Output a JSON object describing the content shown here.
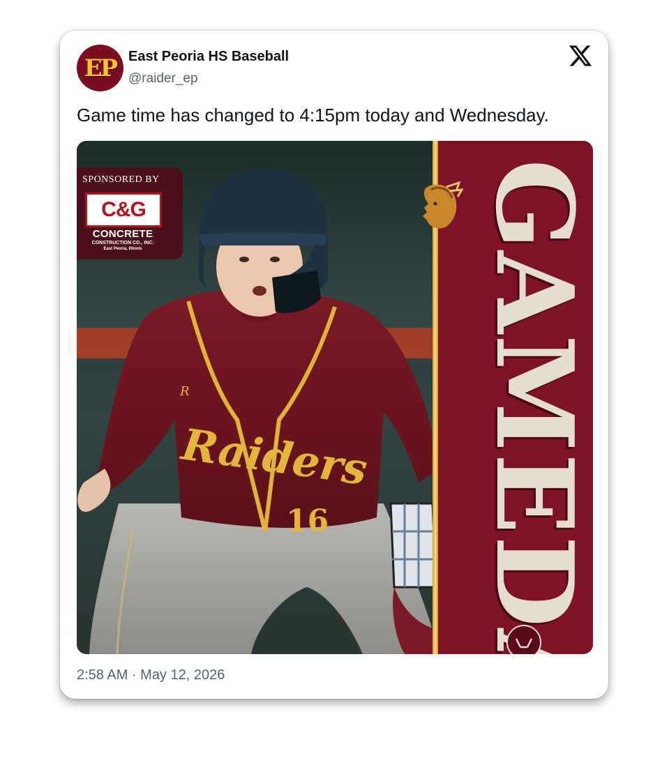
{
  "author": {
    "name": "East Peoria HS Baseball",
    "handle": "@raider_ep",
    "avatar_text": "EP",
    "avatar_icon": "ep-logo-icon"
  },
  "platform_icon": "x-logo-icon",
  "tweet": {
    "text": "Game time has changed to 4:15pm today and Wednesday.",
    "timestamp": "2:58 AM · May 12, 2026"
  },
  "media": {
    "sponsor_label": "SPONSORED BY",
    "sponsor_logo_text": "C&G",
    "sponsor_name": "CONCRETE",
    "sponsor_sub": "CONSTRUCTION CO., INC.",
    "sponsor_city": "East Peoria, Illinois",
    "banner_text": "GAMEDAY",
    "jersey_text": "Raiders",
    "jersey_number": "16"
  },
  "colors": {
    "brand_maroon": "#7e1226",
    "brand_gold": "#f2c230",
    "text_primary": "#0f1419",
    "text_secondary": "#536471"
  }
}
